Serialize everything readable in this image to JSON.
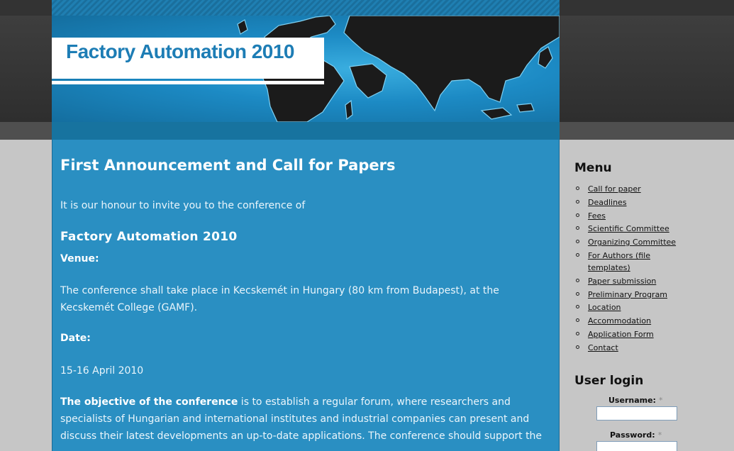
{
  "header": {
    "site_title": "Factory Automation 2010"
  },
  "main": {
    "heading": "First Announcement and Call for Papers",
    "intro": "It is our honour to invite you to the conference of",
    "conference_name": "Factory Automation 2010",
    "venue_label": "Venue:",
    "venue_text": "The conference shall take place in Kecskemét in Hungary (80 km from Budapest), at the Kecskemét College (GAMF).",
    "date_label": "Date:",
    "date_text": "15-16 April 2010",
    "objective_lead": "The objective of the conference",
    "objective_text": " is to establish a regular forum, where researchers and specialists of Hungarian and international institutes and industrial companies can present and discuss their latest developments an up-to-date applications. The conference should support the"
  },
  "sidebar": {
    "menu_title": "Menu",
    "menu_items": [
      {
        "label": "Call for paper"
      },
      {
        "label": "Deadlines"
      },
      {
        "label": "Fees"
      },
      {
        "label": "Scientific Committee"
      },
      {
        "label": "Organizing Committee"
      },
      {
        "label": "For Authors (file templates)"
      },
      {
        "label": "Paper submission"
      },
      {
        "label": "Preliminary Program"
      },
      {
        "label": "Location"
      },
      {
        "label": "Accommodation"
      },
      {
        "label": "Application Form"
      },
      {
        "label": "Contact"
      }
    ],
    "login_title": "User login",
    "username_label": "Username:",
    "password_label": "Password:",
    "required_mark": "*"
  }
}
